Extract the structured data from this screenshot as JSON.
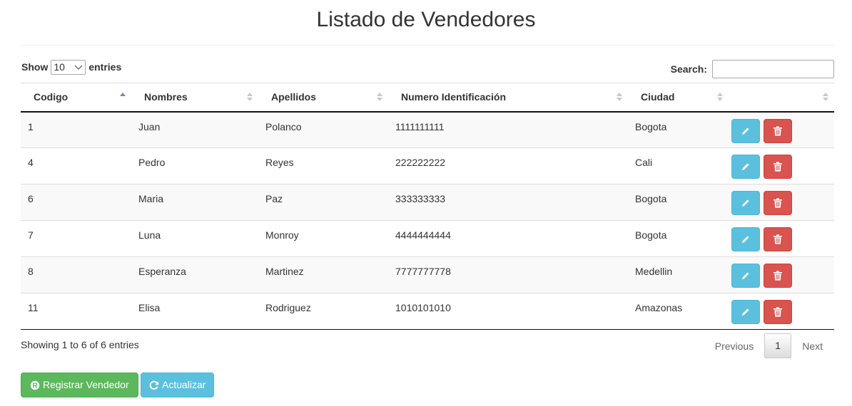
{
  "page": {
    "title": "Listado de Vendedores"
  },
  "controls": {
    "show_label": "Show",
    "length_value": "10",
    "entries_label": "entries",
    "search_label": "Search:",
    "search_value": ""
  },
  "table": {
    "columns": [
      "Codigo",
      "Nombres",
      "Apellidos",
      "Numero Identificación",
      "Ciudad",
      ""
    ],
    "sorted_column": "Codigo",
    "sort_direction": "asc",
    "rows": [
      {
        "codigo": "1",
        "nombres": "Juan",
        "apellidos": "Polanco",
        "identificacion": "1111111111",
        "ciudad": "Bogota"
      },
      {
        "codigo": "4",
        "nombres": "Pedro",
        "apellidos": "Reyes",
        "identificacion": "222222222",
        "ciudad": "Cali"
      },
      {
        "codigo": "6",
        "nombres": "Maria",
        "apellidos": "Paz",
        "identificacion": "333333333",
        "ciudad": "Bogota"
      },
      {
        "codigo": "7",
        "nombres": "Luna",
        "apellidos": "Monroy",
        "identificacion": "4444444444",
        "ciudad": "Bogota"
      },
      {
        "codigo": "8",
        "nombres": "Esperanza",
        "apellidos": "Martinez",
        "identificacion": "7777777778",
        "ciudad": "Medellin"
      },
      {
        "codigo": "11",
        "nombres": "Elisa",
        "apellidos": "Rodriguez",
        "identificacion": "1010101010",
        "ciudad": "Amazonas"
      }
    ],
    "row_actions": [
      {
        "icon": "pencil-icon",
        "color": "#5bc0de"
      },
      {
        "icon": "trash-icon",
        "color": "#d9534f"
      }
    ]
  },
  "footer": {
    "info": "Showing 1 to 6 of 6 entries",
    "previous": "Previous",
    "current_page": "1",
    "next": "Next"
  },
  "buttons": {
    "register": {
      "label": "Registrar Vendedor",
      "icon": "registered-icon",
      "color": "#5cb85c"
    },
    "refresh": {
      "label": "Actualizar",
      "icon": "refresh-icon",
      "color": "#5bc0de"
    }
  }
}
